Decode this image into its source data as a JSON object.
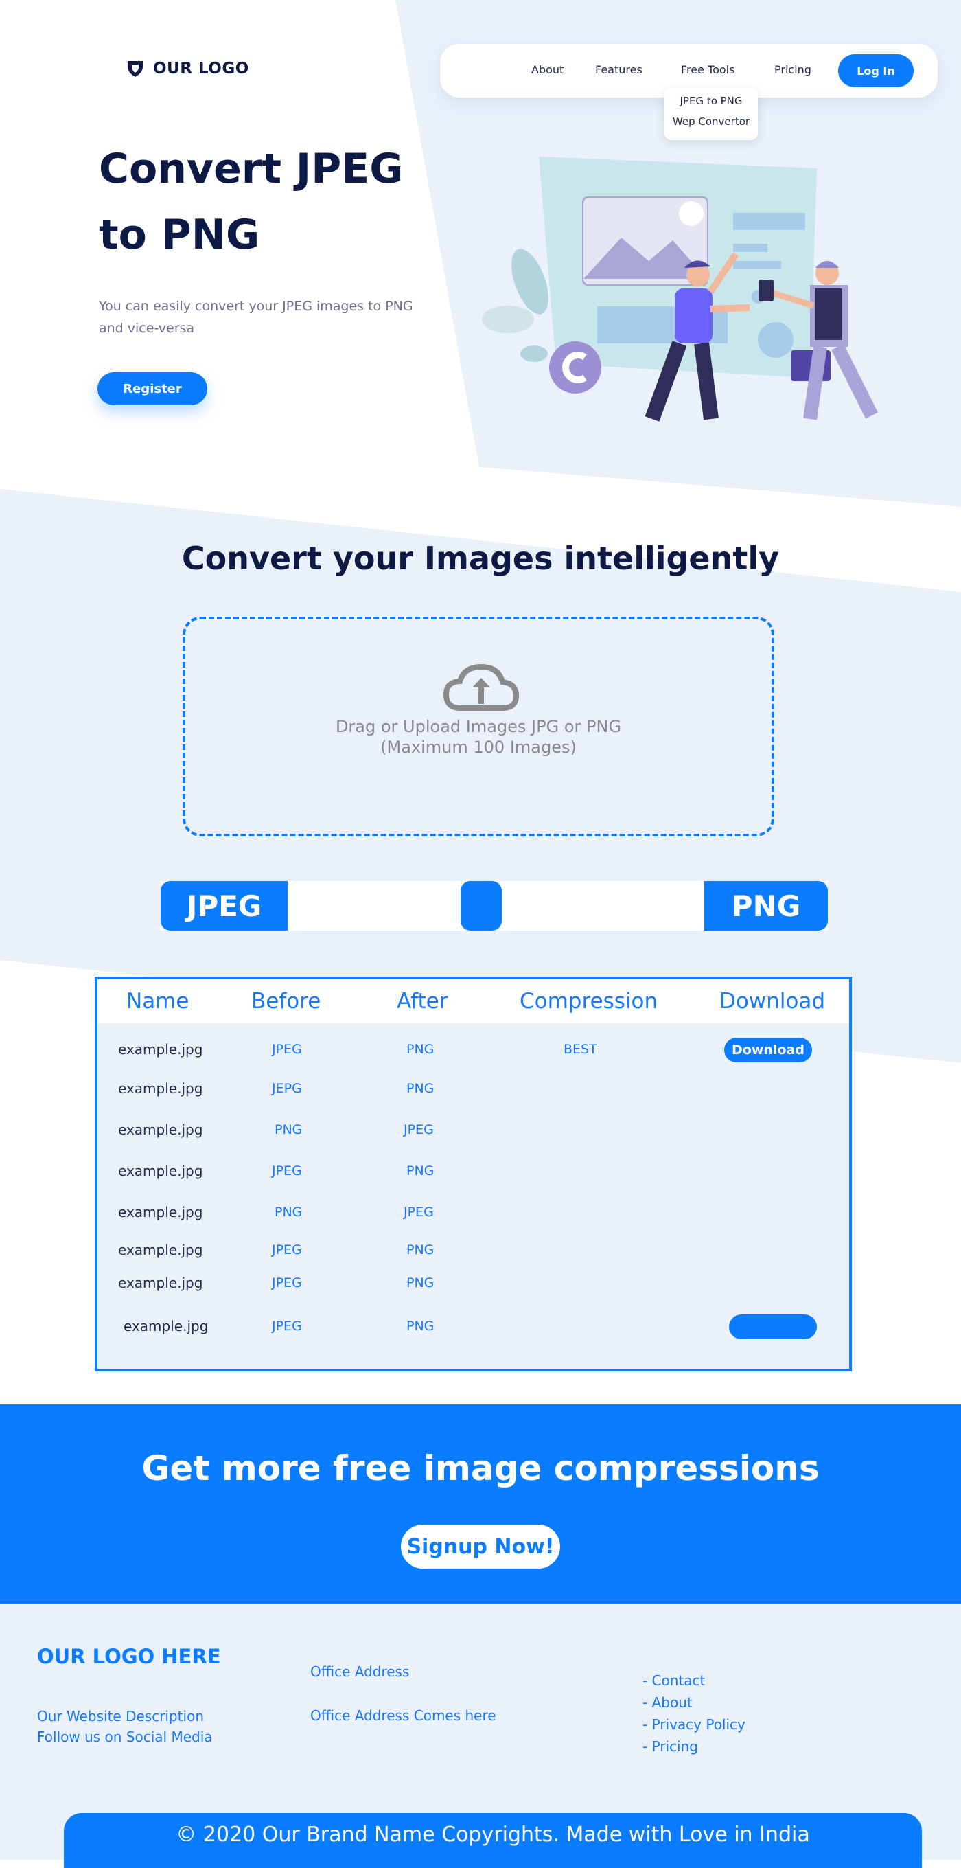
{
  "colors": {
    "accent": "#0a7cff",
    "navy": "#0d1a45",
    "light_bg": "#eaf1fb"
  },
  "header": {
    "logo_text": "OUR LOGO",
    "logo_icon": "shield-icon",
    "nav": [
      {
        "label": "About"
      },
      {
        "label": "Features"
      },
      {
        "label": "Free Tools"
      },
      {
        "label": "Pricing"
      }
    ],
    "login_label": "Log In",
    "dropdown": [
      "JPEG to PNG",
      "Wep Convertor"
    ]
  },
  "hero": {
    "title_line1": "Convert JPEG",
    "title_line2": "to PNG",
    "subtitle": "You can easily convert your JPEG images to PNG and vice-versa",
    "register_label": "Register"
  },
  "converter": {
    "title": "Convert your Images intelligently",
    "upload_icon": "cloud-upload-icon",
    "drop_line1": "Drag or Upload Images JPG or PNG",
    "drop_line2": "(Maximum 100 Images)",
    "from_label": "JPEG",
    "to_label": "PNG"
  },
  "table": {
    "headers": [
      "Name",
      "Before",
      "After",
      "Compression",
      "Download"
    ],
    "rows": [
      {
        "name": "example.jpg",
        "before": "JPEG",
        "after": "PNG",
        "compression": "BEST",
        "download": "Download"
      },
      {
        "name": "example.jpg",
        "before": "JEPG",
        "after": "PNG",
        "compression": "",
        "download": ""
      },
      {
        "name": "example.jpg",
        "before": "PNG",
        "after": "JPEG",
        "compression": "",
        "download": ""
      },
      {
        "name": "example.jpg",
        "before": "JPEG",
        "after": "PNG",
        "compression": "",
        "download": ""
      },
      {
        "name": "example.jpg",
        "before": "PNG",
        "after": "JPEG",
        "compression": "",
        "download": ""
      },
      {
        "name": "example.jpg",
        "before": "JPEG",
        "after": "PNG",
        "compression": "",
        "download": ""
      },
      {
        "name": "example.jpg",
        "before": "JPEG",
        "after": "PNG",
        "compression": "",
        "download": ""
      },
      {
        "name": "example.jpg",
        "before": "JPEG",
        "after": "PNG",
        "compression": "",
        "download": ""
      }
    ]
  },
  "cta": {
    "title": "Get more free image compressions",
    "button": "Signup Now!"
  },
  "footer": {
    "logo": "OUR LOGO HERE",
    "description": "Our Website Description",
    "social": "Follow us on Social Media",
    "office_title": "Office Address",
    "office_text": "Office Address Comes here",
    "links": [
      "- Contact",
      "- About",
      "- Privacy Policy",
      "- Pricing"
    ],
    "copyright": "© 2020 Our Brand Name Copyrights. Made with Love in India"
  }
}
